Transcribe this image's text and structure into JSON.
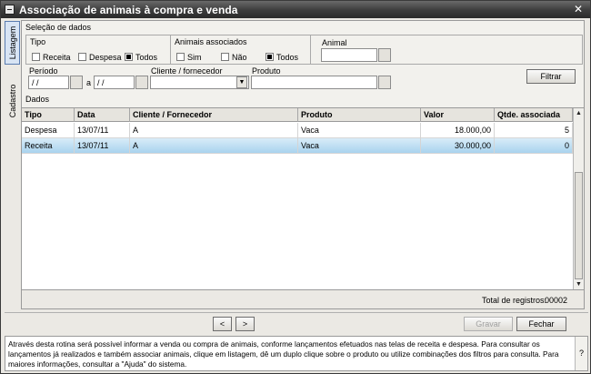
{
  "window": {
    "title": "Associação de animais à compra e venda",
    "close_glyph": "✕"
  },
  "vtabs": {
    "listagem": "Listagem",
    "cadastro": "Cadastro"
  },
  "filters": {
    "section_title": "Seleção de dados",
    "tipo": {
      "label": "Tipo",
      "options": [
        "Receita",
        "Despesa",
        "Todos"
      ],
      "selected": "Todos"
    },
    "animais": {
      "label": "Animais associados",
      "options": [
        "Sim",
        "Não",
        "Todos"
      ],
      "selected": "Todos"
    },
    "animal": {
      "label": "Animal",
      "value": ""
    },
    "periodo": {
      "label": "Período",
      "start": " / /",
      "separator": "a",
      "end": " / /"
    },
    "cliente": {
      "label": "Cliente / fornecedor",
      "value": ""
    },
    "produto": {
      "label": "Produto",
      "value": ""
    },
    "filtrar_label": "Filtrar"
  },
  "grid": {
    "title": "Dados",
    "columns": [
      "Tipo",
      "Data",
      "Cliente / Fornecedor",
      "Produto",
      "Valor",
      "Qtde. associada"
    ],
    "rows": [
      {
        "tipo": "Despesa",
        "data": "13/07/11",
        "cliente": "A",
        "produto": "Vaca",
        "valor": "18.000,00",
        "qtde": "5"
      },
      {
        "tipo": "Receita",
        "data": "13/07/11",
        "cliente": "A",
        "produto": "Vaca",
        "valor": "30.000,00",
        "qtde": "0"
      }
    ],
    "selected_row": 1,
    "total_label": "Total de registros:",
    "total_value": "00002"
  },
  "nav": {
    "prev": "<",
    "next": ">"
  },
  "actions": {
    "gravar": "Gravar",
    "fechar": "Fechar"
  },
  "help": {
    "text": "Através desta rotina será possível informar a venda ou compra de animais, conforme lançamentos efetuados nas telas de receita e despesa. Para consultar os lançamentos já realizados e também associar animais, clique em listagem, dê um duplo clique sobre o produto ou utilize combinações dos filtros para consulta. Para maiores informações, consultar a \"Ajuda\" do sistema.",
    "help_glyph": "?"
  }
}
